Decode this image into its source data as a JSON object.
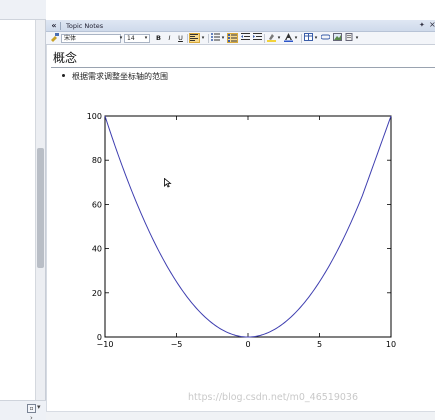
{
  "notes_pane": {
    "title": "Topic Notes",
    "collapse_label": "«",
    "pin_label": "✦",
    "close_label": "×"
  },
  "toolbar": {
    "font_name": "宋体",
    "font_size": "14",
    "bold_label": "B",
    "italic_label": "I",
    "underline_label": "U",
    "accent_color": "#f7d98c"
  },
  "note": {
    "heading": "概念",
    "bullet": "根据需求调整坐标轴的范围"
  },
  "chart_data": {
    "type": "line",
    "title": "",
    "xlabel": "",
    "ylabel": "",
    "xlim": [
      -10,
      10
    ],
    "ylim": [
      0,
      100
    ],
    "x_ticks": [
      -10,
      -5,
      0,
      5,
      10
    ],
    "y_ticks": [
      0,
      20,
      40,
      60,
      80,
      100
    ],
    "x_tick_labels": [
      "−10",
      "−5",
      "0",
      "5",
      "10"
    ],
    "y_tick_labels": [
      "0",
      "20",
      "40",
      "60",
      "80",
      "100"
    ],
    "grid": false,
    "series": [
      {
        "x": [
          -10,
          -8,
          -6,
          -4,
          -2,
          0,
          2,
          4,
          6,
          8,
          10
        ],
        "y": [
          100,
          64,
          36,
          16,
          4,
          0,
          4,
          16,
          36,
          64,
          100
        ],
        "color": "#3f3fb0"
      }
    ]
  },
  "watermark": "https://blog.csdn.net/m0_46519036",
  "left_pane": {
    "scroll_down": "▾",
    "bottom_arrow": "▾",
    "bottom_right": "›"
  }
}
